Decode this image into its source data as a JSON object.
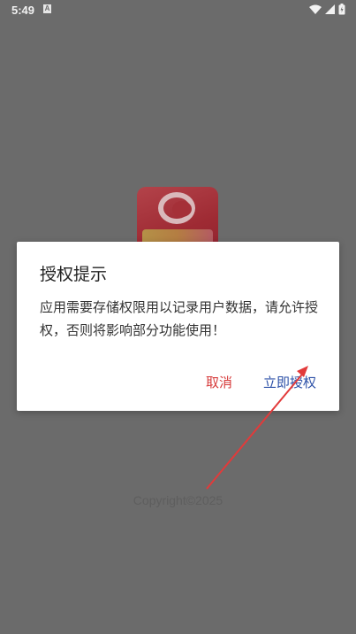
{
  "status_bar": {
    "time": "5:49",
    "notification_icon": "A",
    "icons": [
      "wifi-icon",
      "signal-icon",
      "battery-icon"
    ]
  },
  "splash": {
    "copyright": "Copyright©2025"
  },
  "dialog": {
    "title": "授权提示",
    "message": "应用需要存储权限用以记录用户数据，请允许授权，否则将影响部分功能使用！",
    "cancel_label": "取消",
    "grant_label": "立即授权"
  },
  "colors": {
    "overlay_background": "#6b6b6b",
    "cancel_text": "#d63a3a",
    "grant_text": "#2e52a8",
    "annotation_arrow": "#e23a3a"
  }
}
